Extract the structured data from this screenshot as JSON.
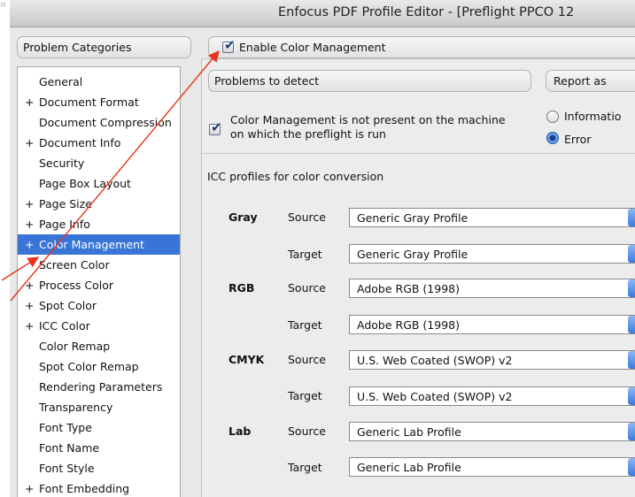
{
  "window": {
    "title": "Enfocus PDF Profile Editor - [Preflight PPCO 12"
  },
  "sidebar": {
    "header": "Problem Categories",
    "items": [
      {
        "label": "General",
        "expand": ""
      },
      {
        "label": "Document Format",
        "expand": "+"
      },
      {
        "label": "Document Compression",
        "expand": ""
      },
      {
        "label": "Document Info",
        "expand": "+"
      },
      {
        "label": "Security",
        "expand": ""
      },
      {
        "label": "Page Box Layout",
        "expand": ""
      },
      {
        "label": "Page Size",
        "expand": "+"
      },
      {
        "label": "Page Info",
        "expand": "+"
      },
      {
        "label": "Color Management",
        "expand": "+",
        "selected": true
      },
      {
        "label": "Screen Color",
        "expand": ""
      },
      {
        "label": "Process Color",
        "expand": "+"
      },
      {
        "label": "Spot Color",
        "expand": "+"
      },
      {
        "label": "ICC Color",
        "expand": "+"
      },
      {
        "label": "Color Remap",
        "expand": ""
      },
      {
        "label": "Spot Color Remap",
        "expand": ""
      },
      {
        "label": "Rendering Parameters",
        "expand": ""
      },
      {
        "label": "Transparency",
        "expand": ""
      },
      {
        "label": "Font Type",
        "expand": ""
      },
      {
        "label": "Font Name",
        "expand": ""
      },
      {
        "label": "Font Style",
        "expand": ""
      },
      {
        "label": "Font Embedding",
        "expand": "+"
      }
    ]
  },
  "enable": {
    "label": "Enable Color Management",
    "checked": true
  },
  "problems": {
    "header": "Problems to detect",
    "line1": "Color Management is not present on the machine",
    "line2": "on which the preflight is run",
    "checked": true
  },
  "report": {
    "header": "Report as",
    "options": [
      "Informatio",
      "Error"
    ],
    "selected": "Error"
  },
  "icc": {
    "heading": "ICC profiles for color conversion",
    "source_label": "Source",
    "target_label": "Target",
    "spaces": [
      {
        "name": "Gray",
        "source": "Generic Gray Profile",
        "target": "Generic Gray Profile"
      },
      {
        "name": "RGB",
        "source": "Adobe RGB (1998)",
        "target": "Adobe RGB (1998)"
      },
      {
        "name": "CMYK",
        "source": "U.S. Web Coated (SWOP) v2",
        "target": "U.S. Web Coated (SWOP) v2"
      },
      {
        "name": "Lab",
        "source": "Generic Lab Profile",
        "target": "Generic Lab Profile"
      }
    ]
  },
  "annotation": {
    "color": "#e8341c"
  },
  "colors": {
    "selection": "#3875d7",
    "accent": "#3b7be0"
  }
}
